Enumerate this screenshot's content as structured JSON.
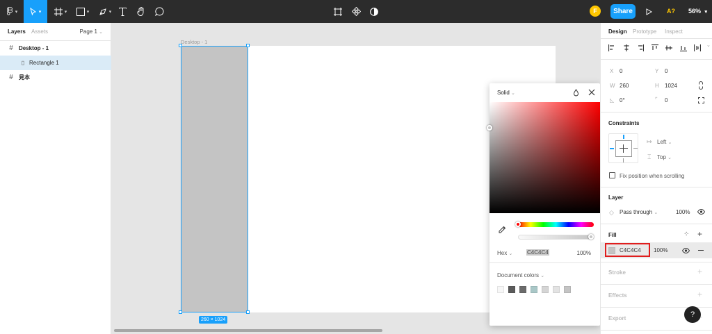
{
  "toolbar": {
    "tools": [
      "main-menu",
      "move",
      "frame",
      "shape",
      "pen",
      "text",
      "hand",
      "comment"
    ],
    "center_tools": [
      "component",
      "component-set",
      "mask"
    ],
    "avatar_initial": "F",
    "share_label": "Share",
    "a_badge": "A?",
    "zoom": "56%",
    "accent_color": "#18a0fb"
  },
  "left_panel": {
    "tabs": [
      "Layers",
      "Assets"
    ],
    "page_selector": "Page 1",
    "layers": [
      "Desktop - 1",
      "Rectangle 1",
      "見本"
    ]
  },
  "canvas": {
    "frame_label": "Desktop - 1",
    "size_badge": "260 × 1024",
    "rect_color": "#c4c4c4"
  },
  "color_picker": {
    "mode": "Solid",
    "hex_label": "Hex",
    "hex_value": "C4C4C4",
    "opacity": "100%",
    "document_colors_label": "Document colors",
    "document_colors": [
      "#f7f7f7",
      "#5b5b5b",
      "#6b6b6b",
      "#a9c7c7",
      "#d5d5d5",
      "#e3e3e3",
      "#c4c4c4"
    ]
  },
  "right_panel": {
    "tabs": [
      "Design",
      "Prototype",
      "Inspect"
    ],
    "x_label": "X",
    "x_value": "0",
    "y_label": "Y",
    "y_value": "0",
    "w_label": "W",
    "w_value": "260",
    "h_label": "H",
    "h_value": "1024",
    "rotation": "0°",
    "corner_radius": "0",
    "constraints_title": "Constraints",
    "constraint_horizontal": "Left",
    "constraint_vertical": "Top",
    "fix_position_label": "Fix position when scrolling",
    "layer_title": "Layer",
    "blend_mode": "Pass through",
    "layer_opacity": "100%",
    "fill_title": "Fill",
    "fill_hex": "C4C4C4",
    "fill_opacity": "100%",
    "stroke_title": "Stroke",
    "effects_title": "Effects",
    "export_title": "Export"
  },
  "help_label": "?"
}
